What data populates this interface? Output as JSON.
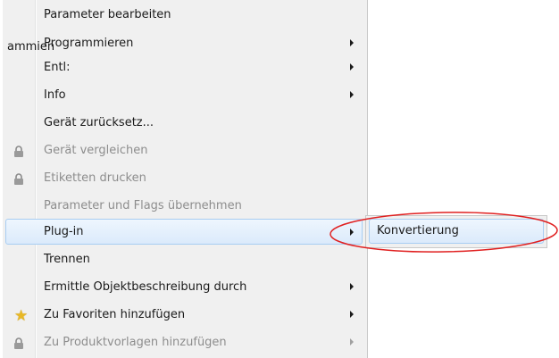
{
  "stray_text": "ammien",
  "menu": {
    "items": [
      {
        "label": "Parameter bearbeiten"
      },
      {
        "label": "Programmieren"
      },
      {
        "label": "Entl:"
      },
      {
        "label": "Info"
      },
      {
        "label": "Gerät zurücksetz..."
      },
      {
        "label": "Gerät vergleichen"
      },
      {
        "label": "Etiketten drucken"
      },
      {
        "label": "Parameter und Flags übernehmen"
      },
      {
        "label": "Plug-in"
      },
      {
        "label": "Trennen"
      },
      {
        "label": "Ermittle Objektbeschreibung durch"
      },
      {
        "label": "Zu Favoriten hinzufügen"
      },
      {
        "label": "Zu Produktvorlagen hinzufügen"
      }
    ]
  },
  "submenu": {
    "items": [
      {
        "label": "Konvertierung"
      }
    ]
  },
  "colors": {
    "highlight_border": "#a8cdf2",
    "annotation": "#e02020",
    "star": "#e8b825"
  },
  "icons": {
    "lock": "lock-icon",
    "star": "star-icon",
    "arrow": "submenu-arrow-icon"
  }
}
